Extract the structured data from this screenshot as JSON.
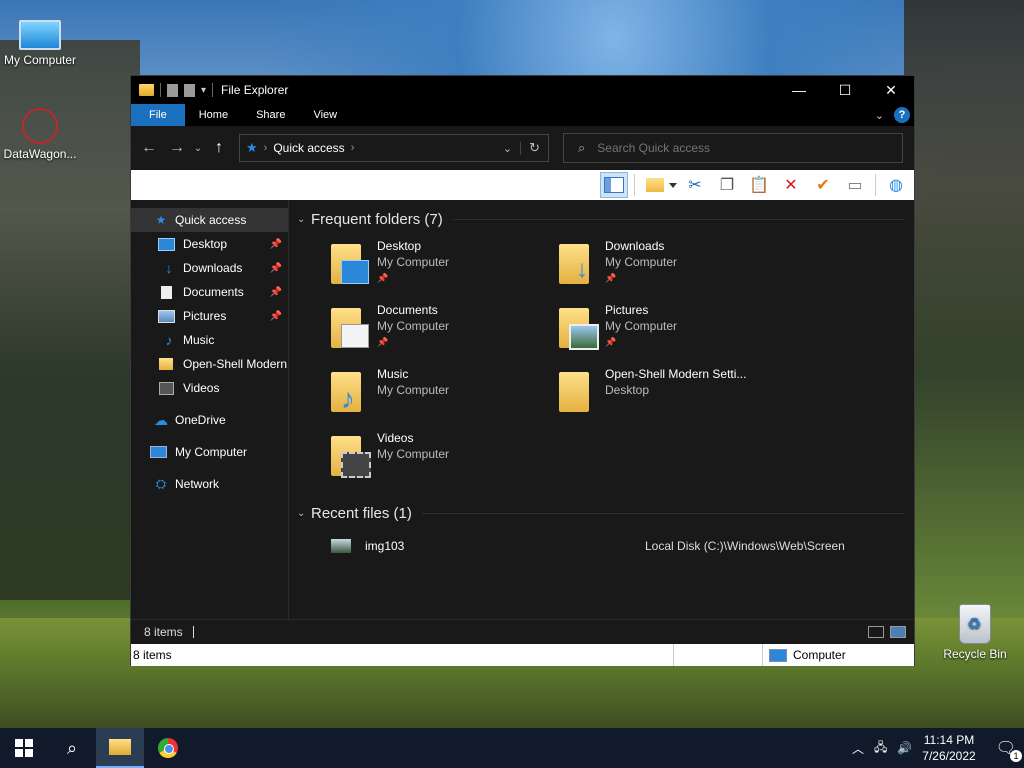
{
  "desktop": {
    "icons": [
      {
        "label": "My Computer"
      },
      {
        "label": "DataWagon..."
      },
      {
        "label": "Recycle Bin"
      }
    ]
  },
  "window": {
    "title": "File Explorer",
    "controls": {
      "minimize": "—",
      "maximize": "☐",
      "close": "✕"
    },
    "ribbon_tabs": [
      "File",
      "Home",
      "Share",
      "View"
    ],
    "help_label": "?",
    "address": {
      "current": "Quick access"
    },
    "search": {
      "placeholder": "Search Quick access"
    },
    "nav_pane": {
      "quick_access": "Quick access",
      "items": [
        {
          "label": "Desktop",
          "icon": "desktop-icon",
          "pinned": true
        },
        {
          "label": "Downloads",
          "icon": "downloads-icon",
          "pinned": true
        },
        {
          "label": "Documents",
          "icon": "documents-icon",
          "pinned": true
        },
        {
          "label": "Pictures",
          "icon": "pictures-icon",
          "pinned": true
        },
        {
          "label": "Music",
          "icon": "music-icon",
          "pinned": false
        },
        {
          "label": "Open-Shell Modern",
          "icon": "folder-icon",
          "pinned": false
        },
        {
          "label": "Videos",
          "icon": "videos-icon",
          "pinned": false
        }
      ],
      "onedrive": "OneDrive",
      "my_computer": "My Computer",
      "network": "Network"
    },
    "frequent": {
      "header": "Frequent folders (7)",
      "folders": [
        {
          "name": "Desktop",
          "location": "My Computer",
          "pinned": true
        },
        {
          "name": "Downloads",
          "location": "My Computer",
          "pinned": true
        },
        {
          "name": "Documents",
          "location": "My Computer",
          "pinned": true
        },
        {
          "name": "Pictures",
          "location": "My Computer",
          "pinned": true
        },
        {
          "name": "Music",
          "location": "My Computer",
          "pinned": false
        },
        {
          "name": "Open-Shell Modern Setti...",
          "location": "Desktop",
          "pinned": false
        },
        {
          "name": "Videos",
          "location": "My Computer",
          "pinned": false
        }
      ]
    },
    "recent": {
      "header": "Recent files (1)",
      "files": [
        {
          "name": "img103",
          "path": "Local Disk (C:)\\Windows\\Web\\Screen"
        }
      ]
    },
    "status": {
      "item_count": "8 items"
    },
    "legacy_status": {
      "item_count": "8 items",
      "zone": "Computer"
    }
  },
  "taskbar": {
    "time": "11:14 PM",
    "date": "7/26/2022",
    "notification_count": "1"
  },
  "colors": {
    "accent": "#1a6fbf",
    "window_bg": "#191919",
    "taskbar_bg": "#101a2a"
  }
}
